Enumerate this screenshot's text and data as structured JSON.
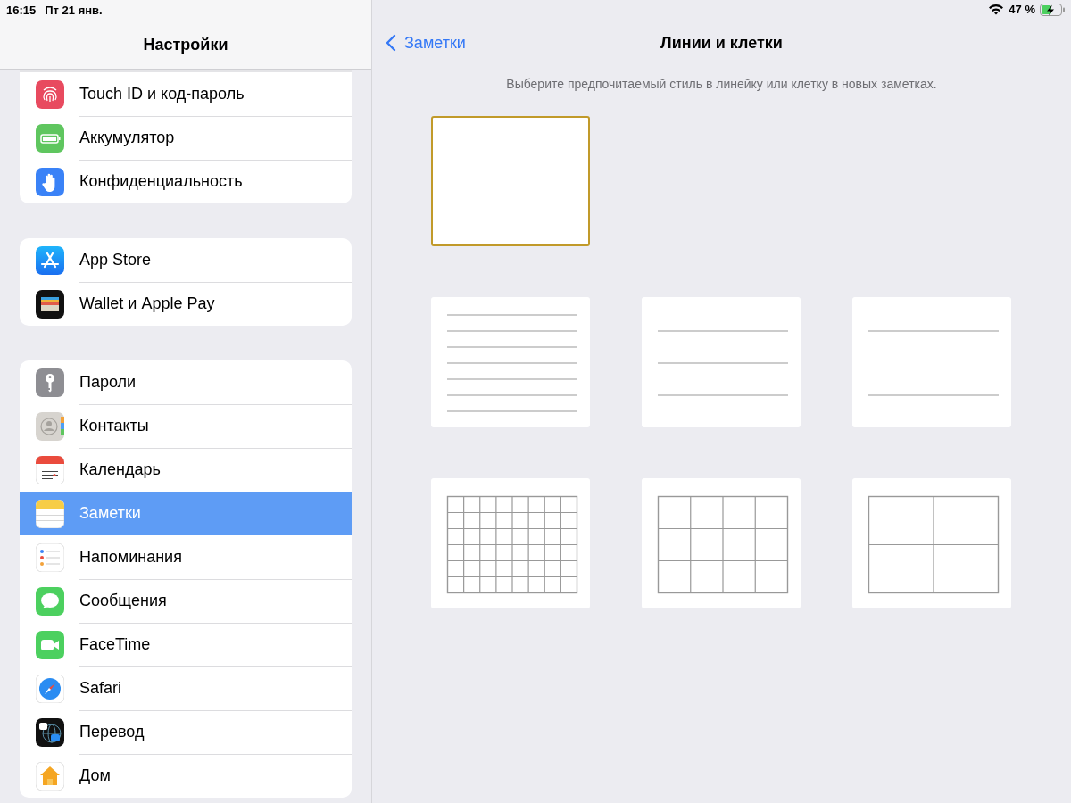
{
  "status_bar": {
    "time": "16:15",
    "date": "Пт 21 янв.",
    "battery_percent": "47 %"
  },
  "sidebar": {
    "title": "Настройки",
    "groups": [
      {
        "items": [
          {
            "label": "Touch ID и код-пароль",
            "selected": false
          },
          {
            "label": "Аккумулятор",
            "selected": false
          },
          {
            "label": "Конфиденциальность",
            "selected": false
          }
        ]
      },
      {
        "items": [
          {
            "label": "App Store",
            "selected": false
          },
          {
            "label": "Wallet и Apple Pay",
            "selected": false
          }
        ]
      },
      {
        "items": [
          {
            "label": "Пароли",
            "selected": false
          },
          {
            "label": "Контакты",
            "selected": false
          },
          {
            "label": "Календарь",
            "selected": false
          },
          {
            "label": "Заметки",
            "selected": true
          },
          {
            "label": "Напоминания",
            "selected": false
          },
          {
            "label": "Сообщения",
            "selected": false
          },
          {
            "label": "FaceTime",
            "selected": false
          },
          {
            "label": "Safari",
            "selected": false
          },
          {
            "label": "Перевод",
            "selected": false
          },
          {
            "label": "Дом",
            "selected": false
          }
        ]
      }
    ]
  },
  "detail": {
    "back_label": "Заметки",
    "title": "Линии и клетки",
    "description": "Выберите предпочитаемый стиль в линейку или клетку в новых заметках.",
    "options": [
      {
        "kind": "blank",
        "selected": true
      },
      {
        "kind": "finelines",
        "selected": false
      },
      {
        "kind": "lines",
        "selected": false
      },
      {
        "kind": "widelines",
        "selected": false
      },
      {
        "kind": "finegrid",
        "selected": false
      },
      {
        "kind": "grid",
        "selected": false
      },
      {
        "kind": "widegrid",
        "selected": false
      }
    ]
  }
}
